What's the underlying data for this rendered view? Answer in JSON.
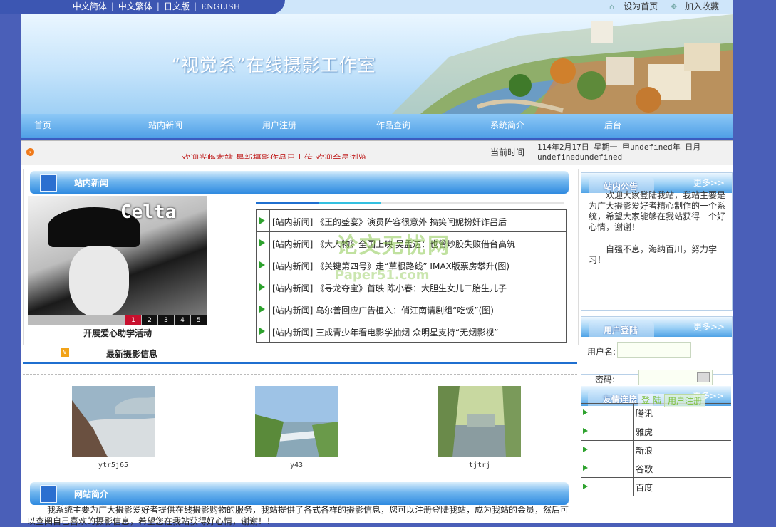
{
  "languages": [
    "中文简体",
    "中文繁体",
    "日文版",
    "ENGLISH"
  ],
  "top_links": {
    "set_home": "设为首页",
    "add_favorite": "加入收藏"
  },
  "banner": {
    "title": "“视觉系”在线摄影工作室"
  },
  "nav": [
    "首页",
    "站内新闻",
    "用户注册",
    "作品查询",
    "系统简介",
    "后台"
  ],
  "marquee": {
    "text": "欢迎光临本站 最新摄影作品已上传 欢迎会员浏览",
    "time_label": "当前时间",
    "time_value": "114年2月17日 星期一 甲undefined年 日月undefinedundefined"
  },
  "news": {
    "header": "站内新闻",
    "photo_caption": "开展爱心助学活动",
    "photo_text": "Celta",
    "pager": [
      "1",
      "2",
      "3",
      "4",
      "5"
    ],
    "items": [
      "[站内新闻] 《王的盛宴》演员阵容很意外 搞笑闫妮扮奸诈吕后",
      "[站内新闻] 《大人物》全国上映 吴孟达：也曾炒股失败借台高筑",
      "[站内新闻] 《关键第四号》走“草根路线” IMAX版票房攀升(图)",
      "[站内新闻] 《寻龙夺宝》首映 陈小春：大胆生女儿二胎生儿子",
      "[站内新闻] 乌尔善回应广告植入：俏江南请剧组“吃饭”(图)",
      "[站内新闻] 三成青少年看电影学抽烟 众明星支持“无烟影视”"
    ]
  },
  "latest": {
    "header": "最新摄影信息",
    "photos": [
      {
        "name": "ytr5j65",
        "colors": [
          "#9bb5c7",
          "#d8dde0",
          "#6a5040",
          "#b8c8d0"
        ]
      },
      {
        "name": "y43",
        "colors": [
          "#9ec3e6",
          "#e8eef2",
          "#5a8a3a",
          "#aab8c0"
        ]
      },
      {
        "name": "tjtrj",
        "colors": [
          "#c8d8a0",
          "#8aa860",
          "#4a6a3a",
          "#a8b8b0"
        ]
      }
    ]
  },
  "intro": {
    "header": "网站简介",
    "text": "我系统主要为广大摄影爱好者提供在线摄影购物的服务，我站提供了各式各样的摄影信息，您可以注册登陆我站，成为我站的会员，然后可以查阅自己喜欢的摄影信息，希望您在我站获得好心情，谢谢！！"
  },
  "notice": {
    "header": "站内公告",
    "more": "更多>>",
    "paragraphs": [
      "欢迎大家登陆我站，我站主要是为广大摄影爱好者精心制作的一个系统，希望大家能够在我站获得一个好心情，谢谢！",
      "自强不息，海纳百川，努力学习！"
    ]
  },
  "login": {
    "header": "用户登陆",
    "more": "更多>>",
    "username_label": "用户名:",
    "password_label": "密码:",
    "login_button": "登 陆",
    "register_button": "用户注册"
  },
  "links": {
    "header": "友情连接",
    "more": "更多>>",
    "items": [
      "腾讯",
      "雅虎",
      "新浪",
      "谷歌",
      "百度"
    ]
  },
  "watermark": {
    "line1": "论文无忧网",
    "line2": "Paper51.com"
  }
}
